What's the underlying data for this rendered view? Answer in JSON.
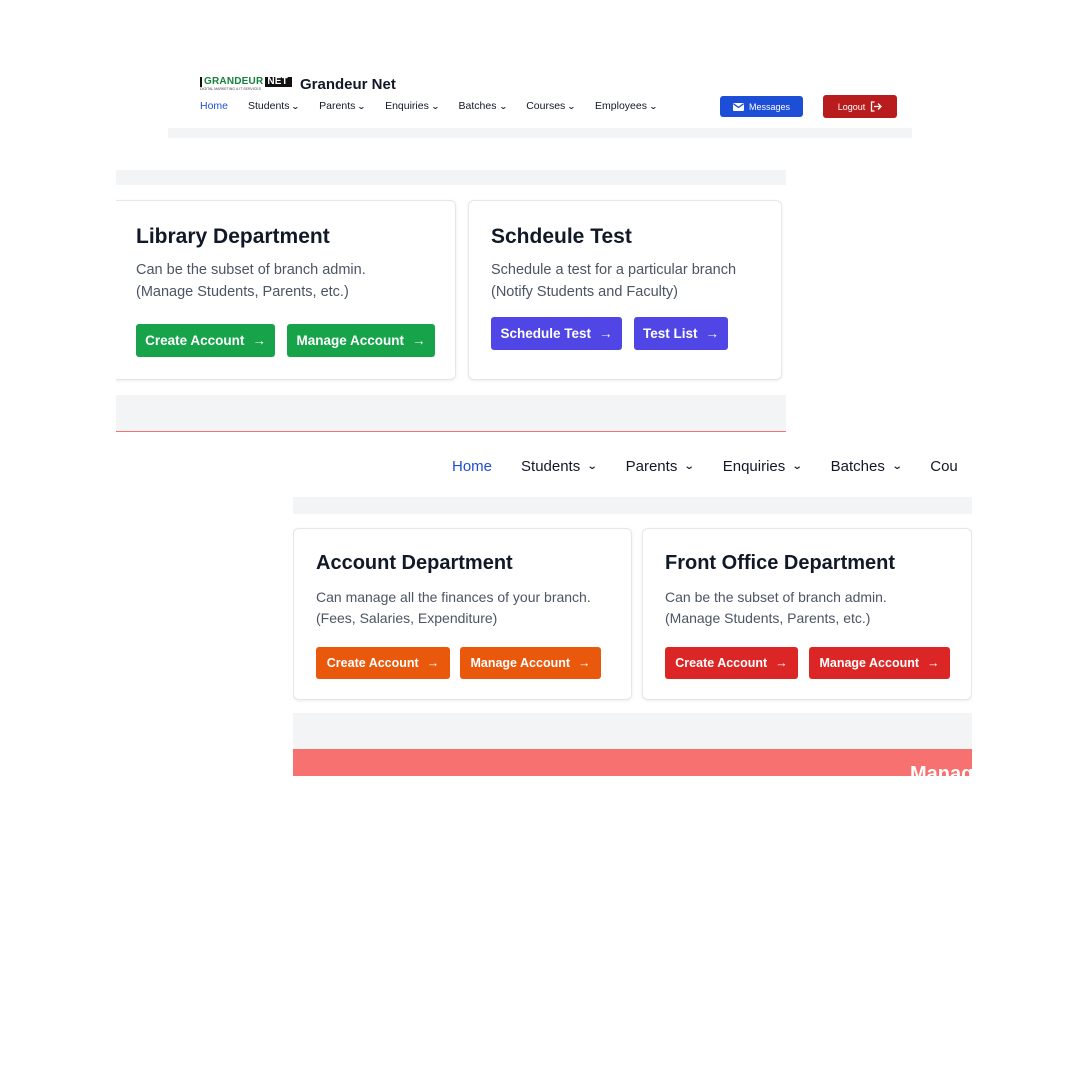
{
  "brand": {
    "logo_main": "GRANDEUR",
    "logo_net": "NET",
    "logo_sub": "DIGITAL MARKETING & IT SERVICES",
    "name": "Grandeur Net"
  },
  "nav": {
    "items": [
      {
        "label": "Home",
        "active": true
      },
      {
        "label": "Students"
      },
      {
        "label": "Parents"
      },
      {
        "label": "Enquiries"
      },
      {
        "label": "Batches"
      },
      {
        "label": "Courses"
      },
      {
        "label": "Employees"
      }
    ],
    "messages_label": "Messages",
    "logout_label": "Logout",
    "zoomed_cut_label": "Cou"
  },
  "cards": {
    "library": {
      "title": "Library Department",
      "desc_line1": "Can be the subset of branch admin.",
      "desc_line2": "(Manage Students, Parents, etc.)",
      "btn1": "Create Account",
      "btn2": "Manage Account",
      "color": "#16a34a"
    },
    "schedule": {
      "title": "Schdeule Test",
      "desc_line1": "Schedule a test for a particular branch",
      "desc_line2": "(Notify Students and Faculty)",
      "btn1": "Schedule Test",
      "btn2": "Test List",
      "color": "#4f46e5"
    },
    "account": {
      "title": "Account Department",
      "desc_line1": "Can manage all the finances of your branch.",
      "desc_line2": "(Fees, Salaries, Expenditure)",
      "btn1": "Create Account",
      "btn2": "Manage Account",
      "color": "#ea580c"
    },
    "front_office": {
      "title": "Front Office Department",
      "desc_line1": "Can be the subset of branch admin.",
      "desc_line2": "(Manage Students, Parents, etc.)",
      "btn1": "Create Account",
      "btn2": "Manage Account",
      "color": "#dc2626"
    }
  },
  "red_band_text": "Manag",
  "icons": {
    "arrow": "→",
    "chevron": "⌄",
    "messages": "mail-icon",
    "logout": "logout-icon"
  },
  "colors": {
    "accent_blue": "#1d4ed8",
    "logout_red": "#b91c1c",
    "band_red": "#f87171"
  }
}
